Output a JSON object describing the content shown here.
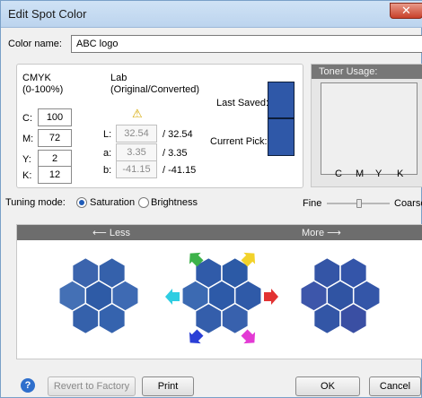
{
  "window": {
    "title": "Edit Spot Color",
    "close_glyph": "✕"
  },
  "color_name": {
    "label": "Color name:",
    "value": "ABC logo"
  },
  "cmyk": {
    "header": "CMYK",
    "range": "(0-100%)",
    "rows": [
      {
        "label": "C:",
        "value": "100"
      },
      {
        "label": "M:",
        "value": "72"
      },
      {
        "label": "Y:",
        "value": "2"
      },
      {
        "label": "K:",
        "value": "12"
      }
    ]
  },
  "lab": {
    "header": "Lab",
    "subheader": "(Original/Converted)",
    "warning_icon": "⚠",
    "rows": [
      {
        "label": "L:",
        "original": "32.54",
        "converted": "/ 32.54"
      },
      {
        "label": "a:",
        "original": "3.35",
        "converted": "/ 3.35"
      },
      {
        "label": "b:",
        "original": "-41.15",
        "converted": "/ -41.15"
      }
    ]
  },
  "swatches": {
    "last_saved": "Last Saved:",
    "current_pick": "Current Pick:",
    "color": "#2f58a8"
  },
  "toner": {
    "title": "Toner Usage:",
    "labels": [
      "C",
      "M",
      "Y",
      "K"
    ]
  },
  "tuning": {
    "label": "Tuning mode:",
    "saturation": "Saturation",
    "brightness": "Brightness",
    "selected": "saturation",
    "fine": "Fine",
    "coarse": "Coarse",
    "slider_value": 0.5
  },
  "tune_panel": {
    "less": "⟵  Less",
    "more": "More  ⟶"
  },
  "hex_colors": {
    "less": [
      "#3b64ad",
      "#3561ab",
      "#4470b5",
      "#2e5ba6",
      "#3e6ab3",
      "#3561ab",
      "#3563ae"
    ],
    "center": [
      "#305ba9",
      "#2c5aa6",
      "#3c6ab2",
      "#2d5aa8",
      "#2f5aa8",
      "#345eab",
      "#3861ad"
    ],
    "more": [
      "#3455a6",
      "#3455a9",
      "#3d56aa",
      "#3054a3",
      "#3456a8",
      "#3356a6",
      "#3a4fa3"
    ]
  },
  "arrows": {
    "up_left": "#3db24a",
    "up_right": "#f2d22a",
    "left": "#2ecde2",
    "right": "#e23232",
    "down_left": "#2a3ed6",
    "down_right": "#e33ad4"
  },
  "buttons": {
    "help": "?",
    "revert": "Revert to Factory",
    "print": "Print",
    "ok": "OK",
    "cancel": "Cancel"
  }
}
